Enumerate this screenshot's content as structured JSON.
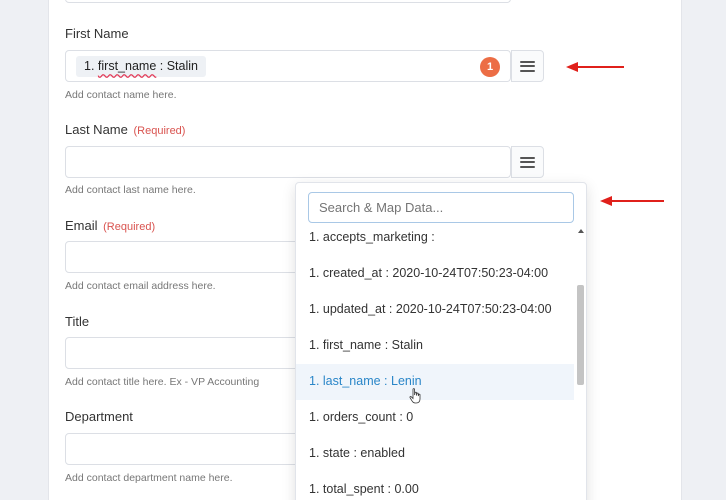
{
  "form": {
    "first_name": {
      "label": "First Name",
      "pill_key": "first_name",
      "pill_prefix": "1.",
      "pill_sep": " : ",
      "pill_value": "Stalin",
      "badge": "1",
      "help": "Add contact name here."
    },
    "last_name": {
      "label": "Last Name",
      "required": "(Required)",
      "help": "Add contact last name here."
    },
    "email": {
      "label": "Email",
      "required": "(Required)",
      "help": "Add contact email address here."
    },
    "title": {
      "label": "Title",
      "help": "Add contact title here. Ex - VP Accounting"
    },
    "department": {
      "label": "Department",
      "help": "Add contact department name here."
    }
  },
  "dropdown": {
    "search_placeholder": "Search & Map Data...",
    "items": [
      "1. accepts_marketing :",
      "1. created_at : 2020-10-24T07:50:23-04:00",
      "1. updated_at : 2020-10-24T07:50:23-04:00",
      "1. first_name : Stalin",
      "1. last_name : Lenin",
      "1. orders_count : 0",
      "1. state : enabled",
      "1. total_spent : 0.00"
    ],
    "hover_index": 4
  },
  "colors": {
    "accent": "#2a86c8",
    "badge": "#ec6d45",
    "required": "#d9534f",
    "arrow": "#e0201b"
  }
}
